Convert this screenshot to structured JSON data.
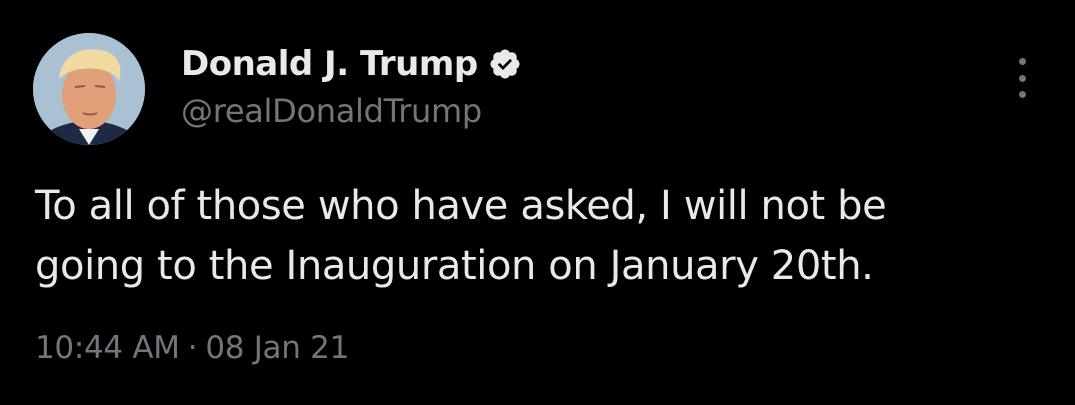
{
  "tweet": {
    "author": {
      "display_name": "Donald J. Trump",
      "handle": "@realDonaldTrump",
      "verified": true,
      "avatar_icon": "profile-photo"
    },
    "text_lines": [
      "To all of those who have asked, I will not be",
      "going to the Inauguration on January 20th."
    ],
    "time": "10:44 AM",
    "separator": "·",
    "date": "08 Jan 21"
  },
  "colors": {
    "background": "#000000",
    "primary_text": "#e7e9ea",
    "secondary_text": "#71767b",
    "verified_badge": "#e7e9ea"
  },
  "icons": {
    "verified": "verified-badge-icon",
    "more": "more-options-icon"
  }
}
